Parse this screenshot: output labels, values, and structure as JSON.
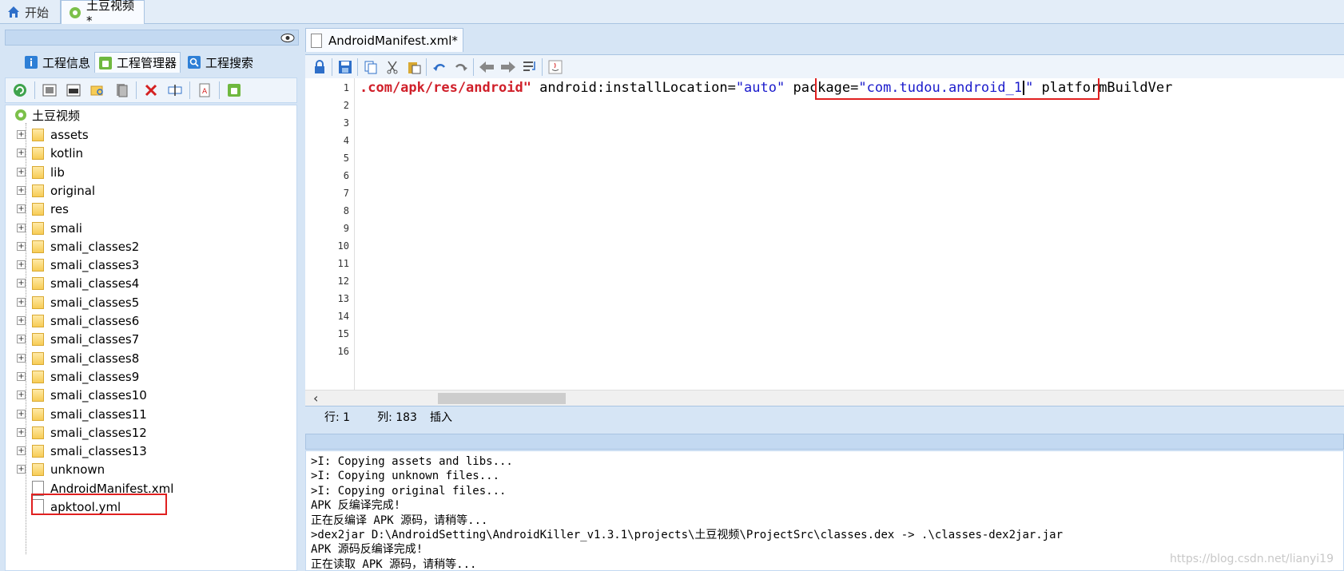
{
  "top_tabs": [
    {
      "label": "开始",
      "icon": "home-icon"
    },
    {
      "label": "土豆视频*",
      "icon": "project-gear-icon"
    }
  ],
  "left_panel": {
    "subtabs": [
      {
        "label": "工程信息",
        "icon": "info-icon"
      },
      {
        "label": "工程管理器",
        "icon": "android-icon"
      },
      {
        "label": "工程搜索",
        "icon": "search-icon"
      }
    ],
    "toolbar_icons": [
      "refresh-icon",
      "image-icon",
      "window-icon",
      "folder-search-icon",
      "pages-icon",
      "delete-icon",
      "rename-icon",
      "text-file-icon",
      "android-icon"
    ],
    "tree": {
      "root": "土豆视频",
      "folders": [
        "assets",
        "kotlin",
        "lib",
        "original",
        "res",
        "smali",
        "smali_classes2",
        "smali_classes3",
        "smali_classes4",
        "smali_classes5",
        "smali_classes6",
        "smali_classes7",
        "smali_classes8",
        "smali_classes9",
        "smali_classes10",
        "smali_classes11",
        "smali_classes12",
        "smali_classes13",
        "unknown"
      ],
      "files": [
        "AndroidManifest.xml",
        "apktool.yml"
      ]
    }
  },
  "editor": {
    "tab_label": "AndroidManifest.xml*",
    "toolbar_icons": [
      "lock-icon",
      "save-icon",
      "copy-icon",
      "cut-icon",
      "paste-icon",
      "undo-icon",
      "redo-icon",
      "back-icon",
      "forward-icon",
      "wrap-icon",
      "java-icon"
    ],
    "line_numbers": [
      "1",
      "2",
      "3",
      "4",
      "5",
      "6",
      "7",
      "8",
      "9",
      "10",
      "11",
      "12",
      "13",
      "14",
      "15",
      "16"
    ],
    "line1": {
      "part1": ".com/apk/res/android\"",
      "part2": " android:installLocation=",
      "part3": "\"auto\"",
      "part4": " package=",
      "part5": "\"com.tudou.android_1",
      "part6": "\"",
      "part7": " platformBuildVer"
    },
    "status": {
      "row": "行: 1",
      "col": "列: 183",
      "mode": "插入"
    }
  },
  "console": {
    "lines": [
      ">I: Copying assets and libs...",
      ">I: Copying unknown files...",
      ">I: Copying original files...",
      "APK 反编译完成!",
      "正在反编译 APK 源码，请稍等...",
      ">dex2jar D:\\AndroidSetting\\AndroidKiller_v1.3.1\\projects\\土豆视频\\ProjectSrc\\classes.dex -> .\\classes-dex2jar.jar",
      "APK 源码反编译完成!",
      "正在读取 APK 源码，请稍等..."
    ]
  },
  "watermark": "https://blog.csdn.net/lianyi19",
  "colors": {
    "highlight_box": "#e02020",
    "xml_string": "#d0202a",
    "xml_value": "#1a1acc",
    "panel_bg": "#d6e5f5"
  }
}
